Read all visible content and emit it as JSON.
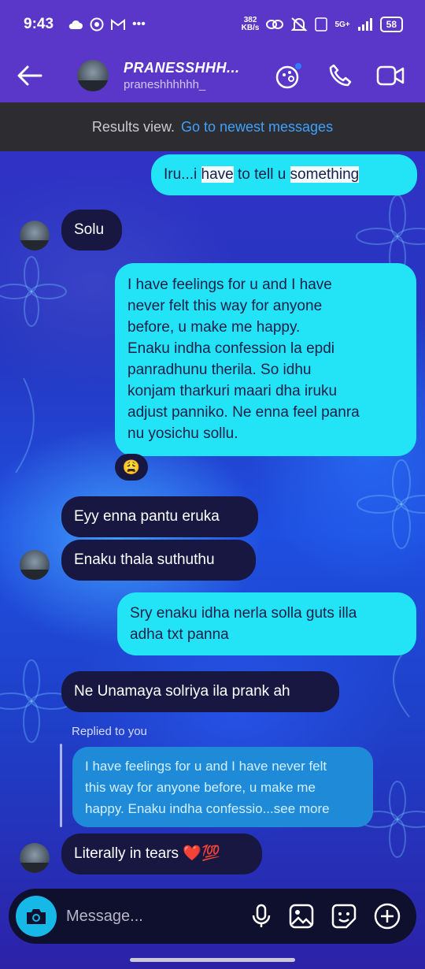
{
  "status_bar": {
    "time": "9:43",
    "speed_value": "382",
    "speed_unit": "KB/s",
    "network": "5G+",
    "battery": "58"
  },
  "header": {
    "name": "PRANESSHHH...",
    "username": "praneshhhhhh_"
  },
  "results_bar": {
    "label": "Results view.",
    "link": "Go to newest messages"
  },
  "messages": {
    "m1_part1": "Iru...i ",
    "m1_hl1": "have",
    "m1_part2": " to tell u  ",
    "m1_hl2": "something",
    "m2": "Solu",
    "m3_lines": [
      "I have feelings for u and I have",
      "never felt this way for anyone",
      "before, u make me happy.",
      "Enaku indha confession la epdi",
      "panradhunu therila. So idhu",
      "konjam tharkuri maari dha iruku",
      "adjust panniko. Ne enna feel panra",
      "nu yosichu sollu."
    ],
    "m3_reaction": "😩",
    "m4": "Eyy enna pantu eruka",
    "m5": "Enaku thala suthuthu",
    "m6_lines": [
      "Sry enaku idha nerla solla guts illa",
      "adha txt panna"
    ],
    "m7": "Ne Unamaya solriya ila prank ah",
    "replied_label": "Replied to you",
    "quoted_lines": [
      "I have feelings for u and I have never felt",
      "this way for anyone before, u make me",
      "happy. Enaku indha confessio...see more"
    ],
    "m8": "Literally in tears ❤️💯"
  },
  "composer": {
    "placeholder": "Message..."
  },
  "colors": {
    "header": "#5b37c9",
    "outgoing_bubble": "#23e3f7",
    "incoming_bubble": "#171742",
    "link": "#3ea1ff"
  },
  "icons": [
    "back-arrow-icon",
    "theme-icon",
    "phone-icon",
    "video-icon",
    "camera-icon",
    "mic-icon",
    "gallery-icon",
    "sticker-icon",
    "plus-icon"
  ]
}
